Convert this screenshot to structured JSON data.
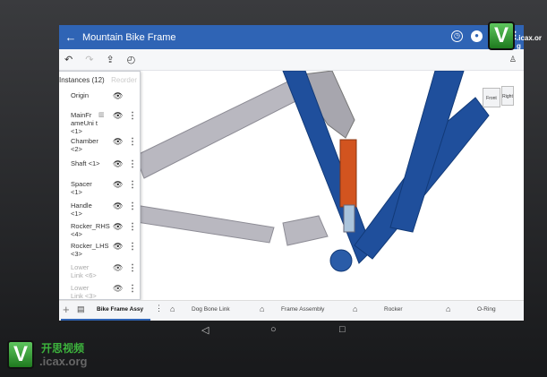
{
  "app": {
    "title": "Mountain Bike Frame",
    "back_icon": "arrow-left-icon"
  },
  "appbar_icons": [
    "history-icon",
    "share-icon",
    "help-icon",
    "more-icon"
  ],
  "toolbar": {
    "undo": "undo-icon",
    "redo": "redo-icon",
    "export": "export-icon",
    "clock": "clock-icon",
    "user": "user-icon"
  },
  "instances": {
    "header": "Instances (12)",
    "action": "Reorder",
    "items": [
      {
        "label": "Origin",
        "visible": true,
        "menu": false
      },
      {
        "label": "MainFr ameUni t <1>",
        "visible": true,
        "menu": true,
        "material": true
      },
      {
        "label": "Chamber <2>",
        "visible": true,
        "menu": true
      },
      {
        "label": "Shaft <1>",
        "visible": true,
        "menu": true
      },
      {
        "label": "Spacer <1>",
        "visible": true,
        "menu": true
      },
      {
        "label": "Handle <1>",
        "visible": true,
        "menu": true
      },
      {
        "label": "Rocker_RHS <4>",
        "visible": true,
        "menu": true
      },
      {
        "label": "Rocker_LHS <3>",
        "visible": true,
        "menu": true
      },
      {
        "label": "Lower Link <6>",
        "visible": false,
        "menu": true
      },
      {
        "label": "Lower Link <3>",
        "visible": false,
        "menu": true
      }
    ]
  },
  "viewcube": {
    "front": "Front",
    "right": "Right"
  },
  "tabs": [
    {
      "label": "Bike Frame Assy",
      "active": true
    },
    {
      "label": "Dog Bone Link"
    },
    {
      "label": "Frame Assembly"
    },
    {
      "label": "Rocker"
    },
    {
      "label": "O-Ring"
    }
  ],
  "watermark": {
    "logo": "V",
    "cn": "开思视频",
    "url": ".icax.org"
  },
  "colors": {
    "appbar": "#2f64b5",
    "frame": "#1f4f9c",
    "shock": "#d2541f"
  }
}
